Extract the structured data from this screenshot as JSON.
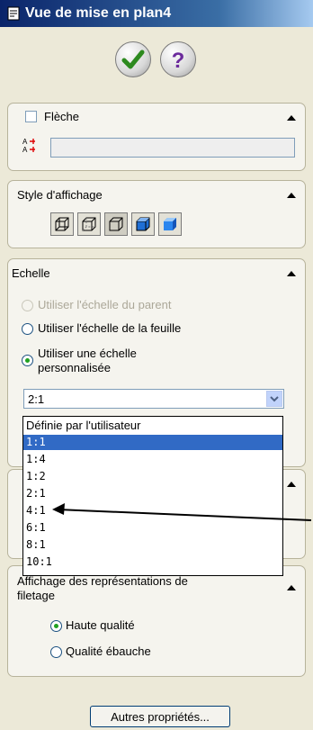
{
  "title": "Vue de mise en plan4",
  "actions": {
    "ok_icon": "checkmark-icon",
    "help_icon": "help-icon"
  },
  "arrow_section": {
    "label": "Flèche",
    "checked": false,
    "text_value": ""
  },
  "display_style": {
    "label": "Style d'affichage",
    "buttons": [
      "wireframe-icon",
      "hidden-lines-visible-icon",
      "hidden-lines-removed-icon",
      "shaded-with-edges-icon",
      "shaded-icon"
    ]
  },
  "scale": {
    "label": "Echelle",
    "options": [
      {
        "label": "Utiliser l'échelle du parent",
        "selected": false,
        "enabled": false
      },
      {
        "label": "Utiliser l'échelle de la feuille",
        "selected": false,
        "enabled": true
      },
      {
        "line1": "Utiliser une échelle",
        "line2": "personnalisée",
        "selected": true,
        "enabled": true
      }
    ],
    "combo_value": "2:1",
    "dropdown_options": [
      "Définie par l'utilisateur",
      "1:1",
      "1:4",
      "1:2",
      "2:1",
      "4:1",
      "6:1",
      "8:1",
      "10:1"
    ],
    "highlighted_option": "1:1"
  },
  "thread_display": {
    "label_line1": "Affichage des représentations de",
    "label_line2": "filetage",
    "options": [
      {
        "label": "Haute qualité",
        "selected": true
      },
      {
        "label": "Qualité ébauche",
        "selected": false
      }
    ]
  },
  "more_button": "Autres propriétés..."
}
